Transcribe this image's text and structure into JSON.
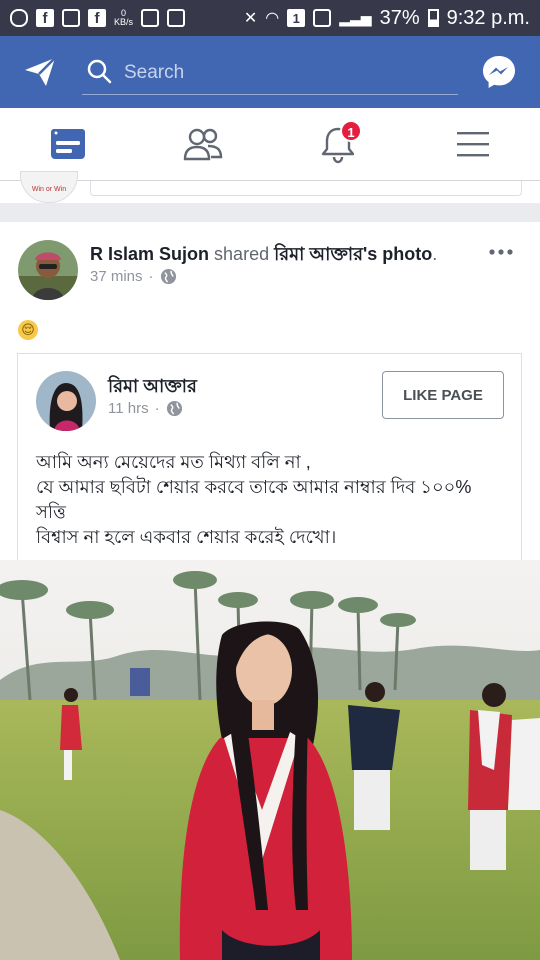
{
  "status_bar": {
    "battery": "37%",
    "time": "9:32 p.m.",
    "speed_unit": "KB/s",
    "speed_value": "0",
    "sim_slot": "1"
  },
  "header": {
    "search_placeholder": "Search",
    "brand_color": "#4267b2"
  },
  "tabs": [
    {
      "name": "news-feed",
      "icon": "news-feed-icon",
      "active": true
    },
    {
      "name": "friends",
      "icon": "friends-icon"
    },
    {
      "name": "notifications",
      "icon": "bell-icon",
      "badge": "1"
    },
    {
      "name": "menu",
      "icon": "hamburger-icon"
    }
  ],
  "prev_post": {
    "logo_text": "Win or Win"
  },
  "post": {
    "author": "R Islam Sujon",
    "action": "shared",
    "shared_owner": "রিমা আক্তার",
    "shared_suffix": "'s photo",
    "period": ".",
    "time": "37 mins",
    "separator": "·",
    "emoji": "😌"
  },
  "shared": {
    "page_name": "রিমা আক্তার",
    "time": "11 hrs",
    "separator": "·",
    "like_button": "LIKE PAGE",
    "text_lines": [
      "আমি অন্য মেয়েদের মত মিথ্যা বলি না ,",
      "যে আমার ছবিটা শেয়ার করবে তাকে আমার নাম্বার দিব ১০০%",
      "সত্তি",
      "বিশ্বাস না হলে একবার শেয়ার করেই দেখো।"
    ]
  }
}
